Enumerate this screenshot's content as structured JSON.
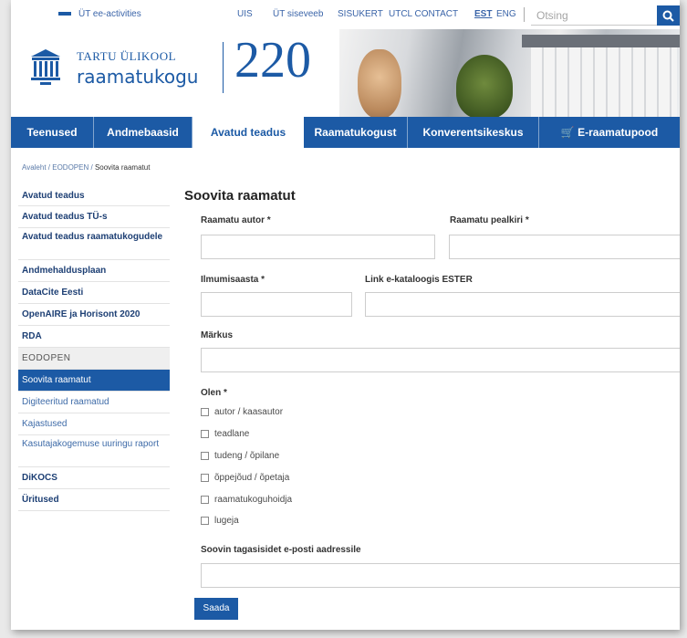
{
  "topbar": {
    "links": [
      "ÜT ee-activities",
      "UIS",
      "ÜT siseveeb",
      "SISUKERT",
      "UTCL CONTACT"
    ],
    "lang_active": "EST",
    "lang_other": "ENG",
    "search_placeholder": "Otsing"
  },
  "header": {
    "logo_line1": "TARTU ÜLIKOOL",
    "logo_line2": "raamatukogu",
    "anniversary": "220"
  },
  "nav": {
    "tabs": [
      "Teenused",
      "Andmebaasid",
      "Avatud teadus",
      "Raamatukogust",
      "Konverentsikeskus",
      "E-raamatupood"
    ],
    "active": "Avatud teadus"
  },
  "breadcrumb": [
    "Avaleht",
    "EODOPEN",
    "Soovita raamatut"
  ],
  "sidebar": {
    "items": [
      {
        "label": "Avatud teadus"
      },
      {
        "label": "Avatud teadus TÜ-s"
      },
      {
        "label": "Avatud teadus raamatukogudele"
      },
      {
        "label": "Andmehaldusplaan"
      },
      {
        "label": "DataCite Eesti"
      },
      {
        "label": "OpenAIRE ja Horisont 2020"
      },
      {
        "label": "RDA"
      },
      {
        "label": "EODOPEN"
      },
      {
        "label": "Soovita raamatut"
      },
      {
        "label": "Digiteeritud raamatud"
      },
      {
        "label": "Kajastused"
      },
      {
        "label": "Kasutajakogemuse uuringu raport"
      },
      {
        "label": "DiKOCS"
      },
      {
        "label": "Üritused"
      }
    ]
  },
  "form": {
    "title": "Soovita raamatut",
    "author_label": "Raamatu autor *",
    "title_label": "Raamatu pealkiri *",
    "year_label": "Ilmumisaasta *",
    "link_label": "Link e-kataloogis ESTER",
    "notes_label": "Märkus",
    "role_label": "Olen *",
    "roles": [
      "autor / kaasautor",
      "teadlane",
      "tudeng / õpilane",
      "õppejõud / õpetaja",
      "raamatukoguhoidja",
      "lugeja"
    ],
    "email_label": "Soovin tagasisidet e-posti aadressile",
    "submit_label": "Saada"
  },
  "colors": {
    "brand": "#1c5aa5",
    "nav_active_bg": "#ffffff"
  },
  "icons": [
    "university-logo-icon",
    "search-icon",
    "shopping-cart-icon"
  ]
}
